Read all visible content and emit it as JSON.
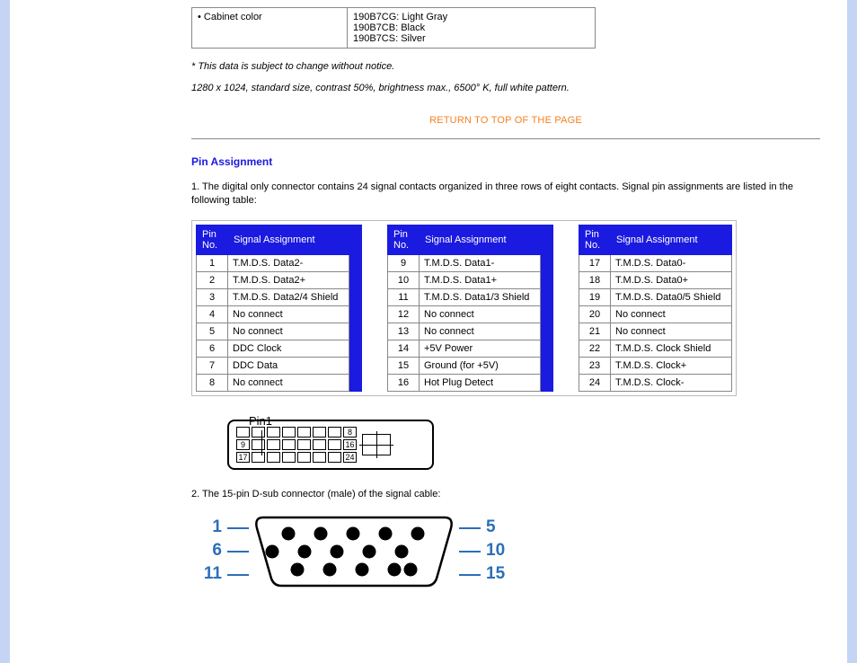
{
  "cabinet": {
    "label": "• Cabinet color",
    "values": [
      "190B7CG: Light Gray",
      "190B7CB: Black",
      "190B7CS: Silver"
    ]
  },
  "note1": "* This data is subject to change without notice.",
  "note2": "1280 x 1024, standard size, contrast 50%, brightness max., 6500° K, full white pattern.",
  "return_link": "RETURN TO TOP OF THE PAGE",
  "section_title": "Pin Assignment",
  "intro": "1. The digital only connector contains 24 signal contacts organized in three rows of eight contacts. Signal pin assignments are listed in the following table:",
  "headers": {
    "pin": "Pin No.",
    "signal": "Signal Assignment"
  },
  "pins": {
    "col1": [
      {
        "n": "1",
        "s": "T.M.D.S. Data2-"
      },
      {
        "n": "2",
        "s": "T.M.D.S. Data2+"
      },
      {
        "n": "3",
        "s": "T.M.D.S. Data2/4 Shield"
      },
      {
        "n": "4",
        "s": "No connect"
      },
      {
        "n": "5",
        "s": "No connect"
      },
      {
        "n": "6",
        "s": "DDC Clock"
      },
      {
        "n": "7",
        "s": "DDC Data"
      },
      {
        "n": "8",
        "s": "No connect"
      }
    ],
    "col2": [
      {
        "n": "9",
        "s": "T.M.D.S. Data1-"
      },
      {
        "n": "10",
        "s": "T.M.D.S. Data1+"
      },
      {
        "n": "11",
        "s": "T.M.D.S. Data1/3 Shield"
      },
      {
        "n": "12",
        "s": "No connect"
      },
      {
        "n": "13",
        "s": "No connect"
      },
      {
        "n": "14",
        "s": "+5V Power"
      },
      {
        "n": "15",
        "s": "Ground (for +5V)"
      },
      {
        "n": "16",
        "s": "Hot Plug Detect"
      }
    ],
    "col3": [
      {
        "n": "17",
        "s": "T.M.D.S. Data0-"
      },
      {
        "n": "18",
        "s": "T.M.D.S. Data0+"
      },
      {
        "n": "19",
        "s": "T.M.D.S. Data0/5 Shield"
      },
      {
        "n": "20",
        "s": "No connect"
      },
      {
        "n": "21",
        "s": "No connect"
      },
      {
        "n": "22",
        "s": "T.M.D.S. Clock Shield"
      },
      {
        "n": "23",
        "s": "T.M.D.S. Clock+"
      },
      {
        "n": "24",
        "s": "T.M.D.S. Clock-"
      }
    ]
  },
  "dvi": {
    "pin1_label": "Pin1",
    "row1_end": "8",
    "row2_start": "9",
    "row2_end": "16",
    "row3_start": "17",
    "row3_end": "24"
  },
  "intro2": "2. The 15-pin D-sub connector (male) of the signal cable:",
  "vga": {
    "left": [
      "1",
      "6",
      "11"
    ],
    "right": [
      "5",
      "10",
      "15"
    ]
  }
}
